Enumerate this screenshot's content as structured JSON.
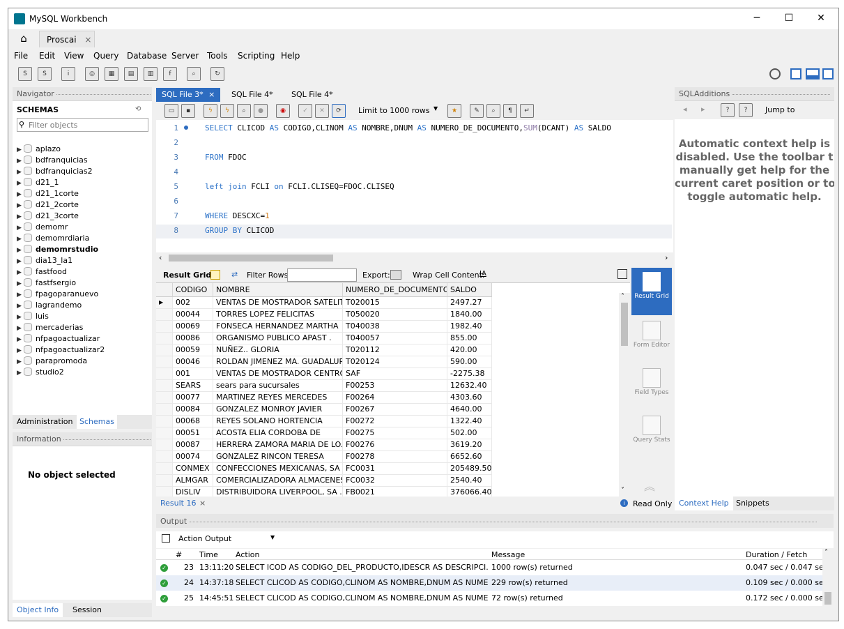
{
  "window": {
    "title": "MySQL Workbench",
    "minimize": "─",
    "maximize": "☐",
    "close": "✕"
  },
  "connection_tab": {
    "label": "Proscai",
    "close": "×"
  },
  "menu": [
    "File",
    "Edit",
    "View",
    "Query",
    "Database",
    "Server",
    "Tools",
    "Scripting",
    "Help"
  ],
  "navigator": {
    "title": "Navigator",
    "schemas_label": "SCHEMAS",
    "filter_placeholder": "Filter objects",
    "schemas": [
      "aplazo",
      "bdfranquicias",
      "bdfranquicias2",
      "d21_1",
      "d21_1corte",
      "d21_2corte",
      "d21_3corte",
      "demomr",
      "demomrdiaria",
      "demomrstudio",
      "dia13_la1",
      "fastfood",
      "fastfsergio",
      "fpagoparanuevo",
      "lagrandemo",
      "luis",
      "mercaderias",
      "nfpagoactualizar",
      "nfpagoactualizar2",
      "parapromoda",
      "studio2"
    ],
    "bold_schema": "demomrstudio",
    "tabs": [
      "Administration",
      "Schemas"
    ]
  },
  "information": {
    "title": "Information",
    "no_object": "No object selected",
    "tabs": [
      "Object Info",
      "Session"
    ]
  },
  "sql_tabs": [
    {
      "label": "SQL File 3*",
      "close": "×"
    },
    {
      "label": "SQL File 4*"
    },
    {
      "label": "SQL File 4*"
    }
  ],
  "editor_toolbar": {
    "limit_label": "Limit to 1000 rows"
  },
  "editor": {
    "lines": [
      "1",
      "2",
      "3",
      "4",
      "5",
      "6",
      "7",
      "8"
    ],
    "l1": {
      "k1": "SELECT",
      "t1": " CLICOD ",
      "k2": "AS",
      "t2": " CODIGO,CLINOM ",
      "k3": "AS",
      "t3": " NOMBRE,DNUM ",
      "k4": "AS",
      "t4": " NUMERO_DE_DOCUMENTO,",
      "f1": "SUM",
      "t5": "(DCANT) ",
      "k5": "AS",
      "t6": " SALDO"
    },
    "l3": {
      "k1": "FROM",
      "t1": " FDOC"
    },
    "l5": {
      "k1": "left",
      "t1": " ",
      "k2": "join",
      "t2": " FCLI ",
      "k3": "on",
      "t3": " FCLI.CLISEQ=FDOC.CLISEQ"
    },
    "l7": {
      "k1": "WHERE",
      "t1": " DESCXC=",
      "n1": "1"
    },
    "l8": {
      "k1": "GROUP BY",
      "t1": " CLICOD"
    }
  },
  "result_toolbar": {
    "result_grid": "Result Grid",
    "filter_rows": "Filter Rows:",
    "export": "Export:",
    "wrap": "Wrap Cell Content:"
  },
  "grid": {
    "columns": [
      "CODIGO",
      "NOMBRE",
      "NUMERO_DE_DOCUMENTO",
      "SALDO"
    ],
    "rows": [
      [
        "002",
        "VENTAS DE MOSTRADOR SATELITE",
        "T020015",
        "2497.27"
      ],
      [
        "00044",
        "TORRES LOPEZ FELICITAS",
        "T050020",
        "1840.00"
      ],
      [
        "00069",
        "FONSECA HERNANDEZ MARTHA",
        "T040038",
        "1982.40"
      ],
      [
        "00086",
        "ORGANISMO PUBLICO APAST .",
        "T040057",
        "855.00"
      ],
      [
        "00059",
        "NUÑEZ.. GLORIA",
        "T020112",
        "420.00"
      ],
      [
        "00046",
        "ROLDAN JIMENEZ MA. GUADALUPE",
        "T020124",
        "590.00"
      ],
      [
        "001",
        "VENTAS DE MOSTRADOR CENTRO",
        "SAF",
        "-2275.38"
      ],
      [
        "SEARS",
        "sears para sucursales",
        "F00253",
        "12632.40"
      ],
      [
        "00077",
        "MARTINEZ REYES MERCEDES",
        "F00264",
        "4303.60"
      ],
      [
        "00084",
        "GONZALEZ MONROY JAVIER",
        "F00267",
        "4640.00"
      ],
      [
        "00068",
        "REYES SOLANO HORTENCIA",
        "F00272",
        "1322.40"
      ],
      [
        "00051",
        "ACOSTA ELIA CORDOBA DE",
        "F00275",
        "502.00"
      ],
      [
        "00087",
        "HERRERA ZAMORA MARIA DE LO...",
        "F00276",
        "3619.20"
      ],
      [
        "00074",
        "GONZALEZ RINCON TERESA",
        "F00278",
        "6652.60"
      ],
      [
        "CONMEX",
        "CONFECCIONES MEXICANAS, SA",
        "FC0031",
        "205489.50"
      ],
      [
        "ALMGAR",
        "COMERCIALIZADORA ALMACENES...",
        "FC0032",
        "2540.40"
      ],
      [
        "DISLIV",
        "DISTRIBUIDORA LIVERPOOL, SA ...",
        "FB0021",
        "376066.40"
      ]
    ]
  },
  "side_buttons": [
    "Result Grid",
    "Form Editor",
    "Field Types",
    "Query Stats"
  ],
  "result_tab": {
    "label": "Result 16",
    "close": "×",
    "read_only": "Read Only"
  },
  "sql_additions": {
    "title": "SQLAdditions",
    "jump_to": "Jump to",
    "help_lines": [
      "Automatic context help is",
      "disabled. Use the toolbar t",
      "manually get help for the",
      "current caret position or to",
      "toggle automatic help."
    ],
    "tabs": [
      "Context Help",
      "Snippets"
    ]
  },
  "output": {
    "title": "Output",
    "selector": "Action Output",
    "columns": [
      "#",
      "Time",
      "Action",
      "Message",
      "Duration / Fetch"
    ],
    "rows": [
      {
        "n": "23",
        "time": "13:11:20",
        "action": "SELECT ICOD AS CODIGO_DEL_PRODUCTO,IDESCR AS DESCRIPCI...",
        "message": "1000 row(s) returned",
        "duration": "0.047 sec / 0.047 sec"
      },
      {
        "n": "24",
        "time": "14:37:18",
        "action": "SELECT CLICOD AS CODIGO,CLINOM AS NOMBRE,DNUM AS NUME...",
        "message": "229 row(s) returned",
        "duration": "0.109 sec / 0.000 sec"
      },
      {
        "n": "25",
        "time": "14:45:51",
        "action": "SELECT CLICOD AS CODIGO,CLINOM AS NOMBRE,DNUM AS NUME...",
        "message": "72 row(s) returned",
        "duration": "0.172 sec / 0.000 sec"
      }
    ]
  }
}
